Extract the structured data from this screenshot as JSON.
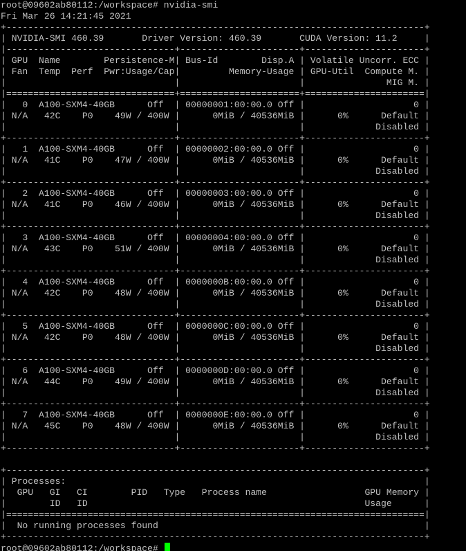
{
  "terminal": {
    "command_line": "root@09602ab80112:/workspace# nvidia-smi",
    "timestamp": "Fri Mar 26 14:21:45 2021",
    "output_lines": [
      "+-----------------------------------------------------------------------------+",
      "| NVIDIA-SMI 460.39       Driver Version: 460.39       CUDA Version: 11.2     |",
      "|-------------------------------+----------------------+----------------------+",
      "| GPU  Name        Persistence-M| Bus-Id        Disp.A | Volatile Uncorr. ECC |",
      "| Fan  Temp  Perf  Pwr:Usage/Cap|         Memory-Usage | GPU-Util  Compute M. |",
      "|                               |                      |               MIG M. |",
      "|===============================+======================+======================|",
      "|   0  A100-SXM4-40GB      Off  | 00000001:00:00.0 Off |                    0 |",
      "| N/A   42C    P0    49W / 400W |      0MiB / 40536MiB |      0%      Default |",
      "|                               |                      |             Disabled |",
      "+-------------------------------+----------------------+----------------------+",
      "|   1  A100-SXM4-40GB      Off  | 00000002:00:00.0 Off |                    0 |",
      "| N/A   41C    P0    47W / 400W |      0MiB / 40536MiB |      0%      Default |",
      "|                               |                      |             Disabled |",
      "+-------------------------------+----------------------+----------------------+",
      "|   2  A100-SXM4-40GB      Off  | 00000003:00:00.0 Off |                    0 |",
      "| N/A   41C    P0    46W / 400W |      0MiB / 40536MiB |      0%      Default |",
      "|                               |                      |             Disabled |",
      "+-------------------------------+----------------------+----------------------+",
      "|   3  A100-SXM4-40GB      Off  | 00000004:00:00.0 Off |                    0 |",
      "| N/A   43C    P0    51W / 400W |      0MiB / 40536MiB |      0%      Default |",
      "|                               |                      |             Disabled |",
      "+-------------------------------+----------------------+----------------------+",
      "|   4  A100-SXM4-40GB      Off  | 0000000B:00:00.0 Off |                    0 |",
      "| N/A   42C    P0    48W / 400W |      0MiB / 40536MiB |      0%      Default |",
      "|                               |                      |             Disabled |",
      "+-------------------------------+----------------------+----------------------+",
      "|   5  A100-SXM4-40GB      Off  | 0000000C:00:00.0 Off |                    0 |",
      "| N/A   42C    P0    48W / 400W |      0MiB / 40536MiB |      0%      Default |",
      "|                               |                      |             Disabled |",
      "+-------------------------------+----------------------+----------------------+",
      "|   6  A100-SXM4-40GB      Off  | 0000000D:00:00.0 Off |                    0 |",
      "| N/A   44C    P0    49W / 400W |      0MiB / 40536MiB |      0%      Default |",
      "|                               |                      |             Disabled |",
      "+-------------------------------+----------------------+----------------------+",
      "|   7  A100-SXM4-40GB      Off  | 0000000E:00:00.0 Off |                    0 |",
      "| N/A   45C    P0    48W / 400W |      0MiB / 40536MiB |      0%      Default |",
      "|                               |                      |             Disabled |",
      "+-------------------------------+----------------------+----------------------+",
      "",
      "+-----------------------------------------------------------------------------+",
      "| Processes:                                                                  |",
      "|  GPU   GI   CI        PID   Type   Process name                  GPU Memory |",
      "|        ID   ID                                                   Usage      |",
      "|=============================================================================|",
      "|  No running processes found                                                 |",
      "+-----------------------------------------------------------------------------+"
    ],
    "final_prompt": "root@09602ab80112:/workspace# ",
    "text_color": "#c0c0c0",
    "background_color": "#000000",
    "cursor_color": "#00ff00"
  }
}
